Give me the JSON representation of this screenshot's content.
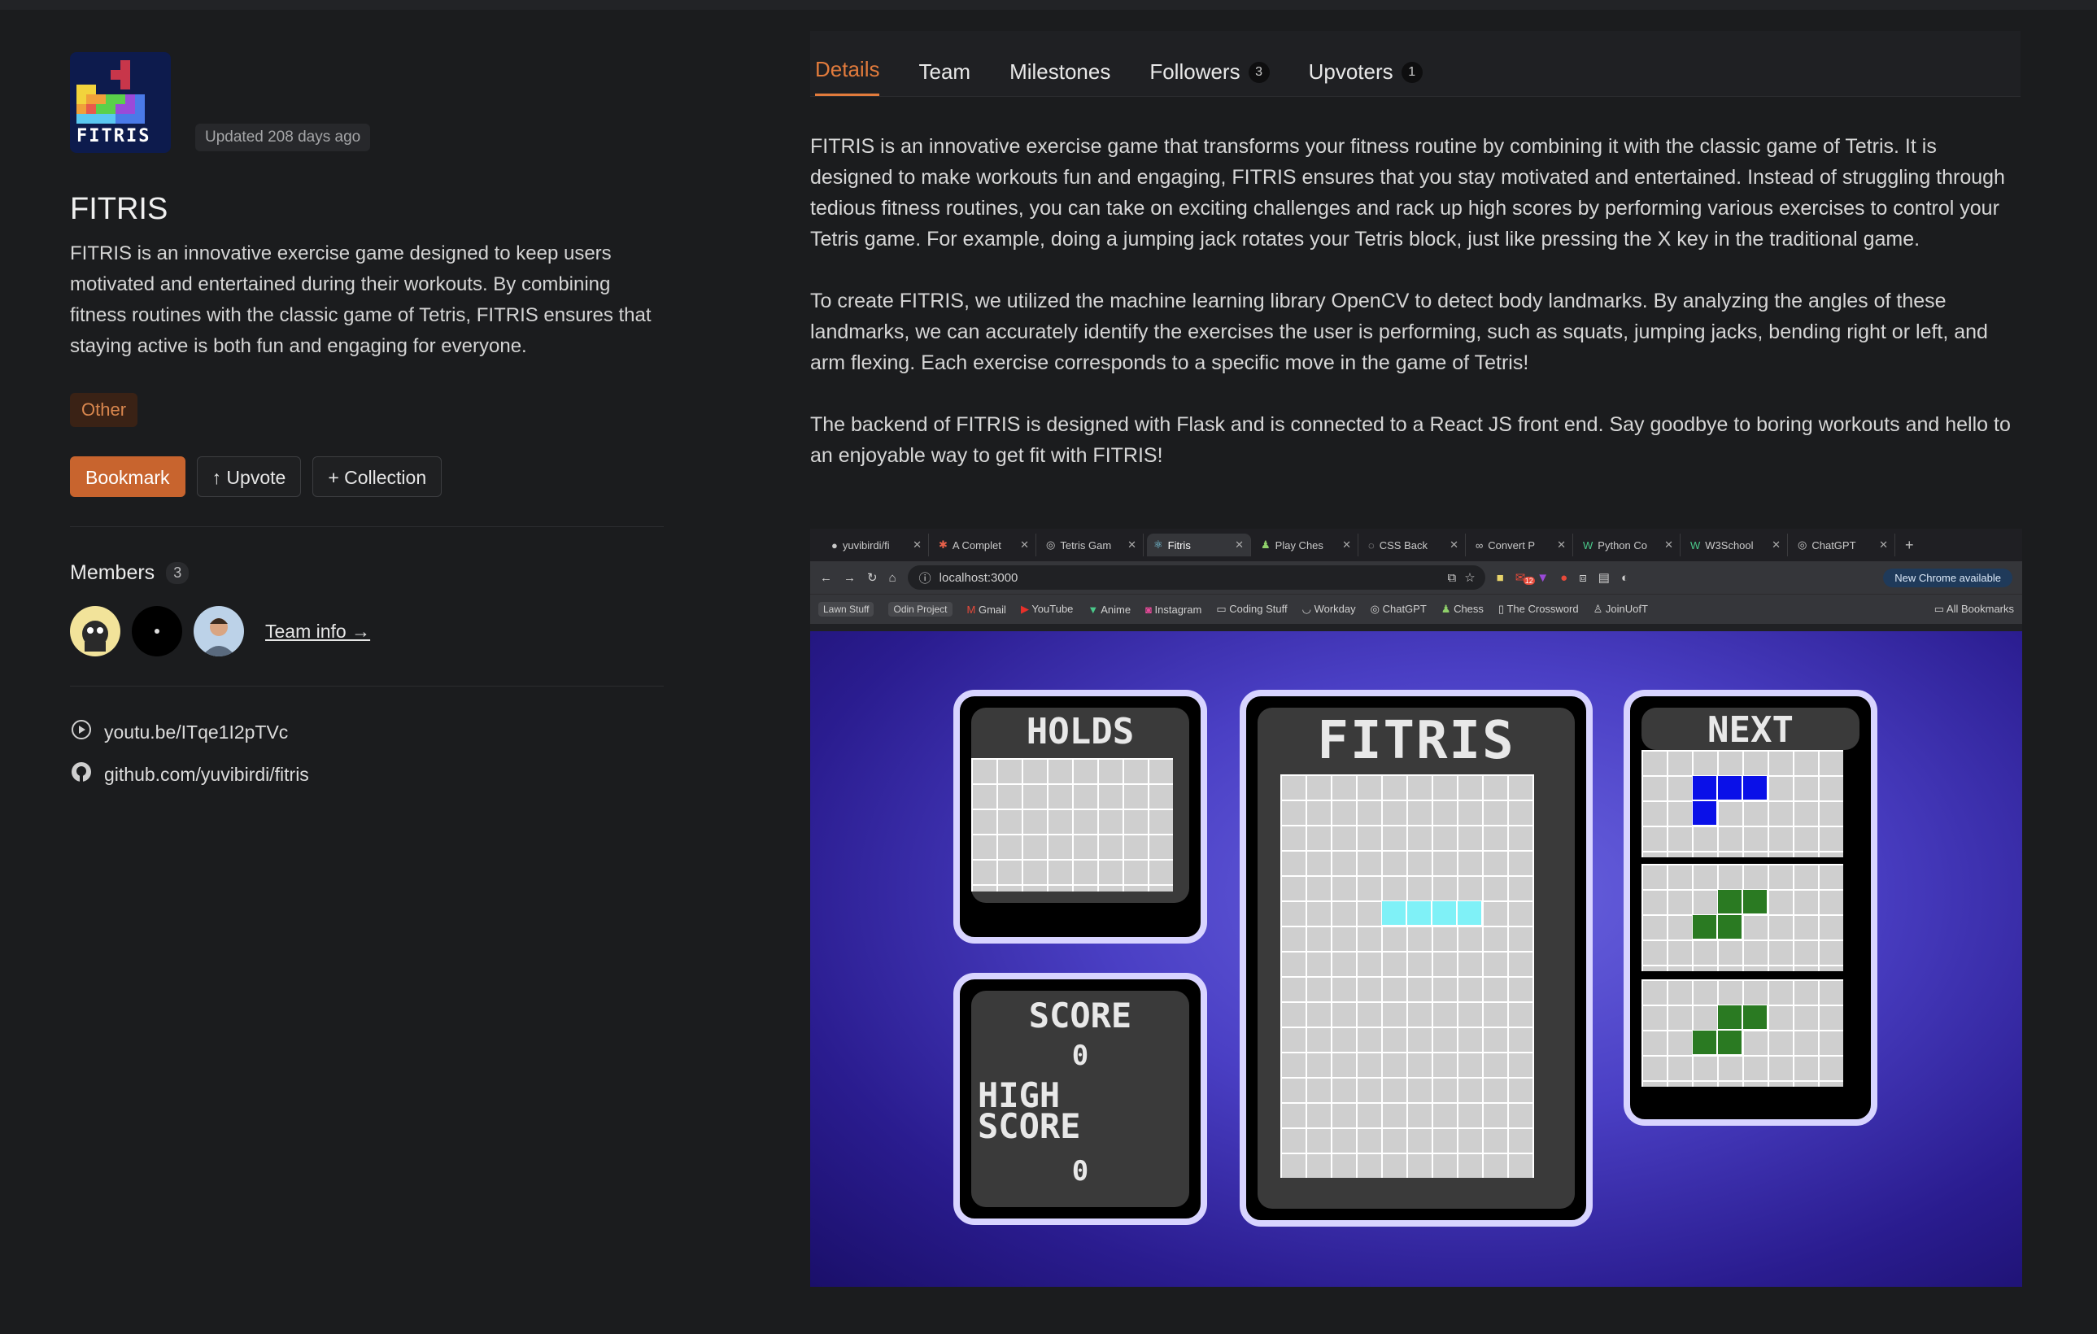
{
  "project": {
    "logo_text": "FITRIS",
    "updated": "Updated 208 days ago",
    "title": "FITRIS",
    "description": "FITRIS is an innovative exercise game designed to keep users motivated and entertained during their workouts. By combining fitness routines with the classic game of Tetris, FITRIS ensures that staying active is both fun and engaging for everyone.",
    "tag": "Other"
  },
  "actions": {
    "bookmark": "Bookmark",
    "upvote": "↑ Upvote",
    "collection": "+ Collection"
  },
  "members": {
    "heading": "Members",
    "count": "3",
    "team_info": "Team info →"
  },
  "links": {
    "youtube": "youtu.be/ITqe1I2pTVc",
    "github": "github.com/yuvibirdi/fitris"
  },
  "tabs": [
    {
      "label": "Details"
    },
    {
      "label": "Team"
    },
    {
      "label": "Milestones"
    },
    {
      "label": "Followers",
      "badge": "3"
    },
    {
      "label": "Upvoters",
      "badge": "1"
    }
  ],
  "details": {
    "p1": "FITRIS is an innovative exercise game that transforms your fitness routine by combining it with the classic game of Tetris. It is designed to make workouts fun and engaging, FITRIS ensures that you stay motivated and entertained. Instead of struggling through tedious fitness routines, you can take on exciting challenges and rack up high scores by performing various exercises to control your Tetris game. For example, doing a jumping jack rotates your Tetris block, just like pressing the X key in the traditional game.",
    "p2": "To create FITRIS, we utilized the machine learning library OpenCV to detect body landmarks. By analyzing the angles of these landmarks, we can accurately identify the exercises the user is performing, such as squats, jumping jacks, bending right or left, and arm flexing. Each exercise corresponds to a specific move in the game of Tetris!",
    "p3": "The backend of FITRIS is designed with Flask and is connected to a React JS front end. Say goodbye to boring workouts and hello to an enjoyable way to get fit with FITRIS!"
  },
  "screenshot": {
    "browser_tabs": [
      "yuvibirdi/fi",
      "A Complet",
      "Tetris Gam",
      "Fitris",
      "Play Ches",
      "CSS Back",
      "Convert P",
      "Python Co",
      "W3School",
      "ChatGPT"
    ],
    "url": "localhost:3000",
    "new_chrome": "New Chrome available",
    "ext_badge": "12",
    "bookmarks": [
      "Gmail",
      "YouTube",
      "Anime",
      "Instagram",
      "Coding Stuff",
      "Workday",
      "ChatGPT",
      "Chess",
      "The Crossword",
      "JoinUofT"
    ],
    "bookmark_pills": [
      "Lawn Stuff",
      "Odin Project"
    ],
    "all_bookmarks": "All Bookmarks",
    "game": {
      "holds": "HOLDS",
      "title": "FITRIS",
      "next": "NEXT",
      "score_label": "SCORE",
      "score": "0",
      "high_score_label_1": "HIGH",
      "high_score_label_2": "SCORE",
      "high_score": "0"
    }
  },
  "colors": {
    "accent": "#e27b3c",
    "bookmark_button": "#c8642e",
    "tag_text": "#d9874e",
    "piece_blue": "#0a10e8",
    "piece_green": "#2a7a22",
    "piece_cyan": "#7ff1f7"
  }
}
